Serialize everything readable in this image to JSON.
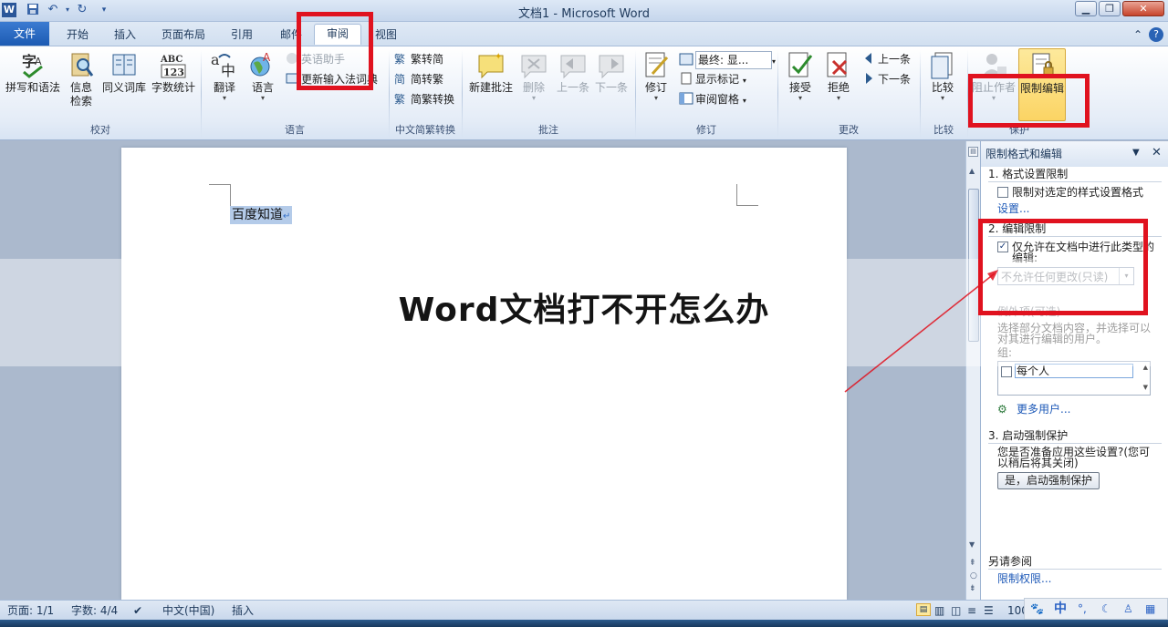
{
  "window": {
    "title": "文档1 - Microsoft Word"
  },
  "tabs": {
    "file": "文件",
    "items": [
      "开始",
      "插入",
      "页面布局",
      "引用",
      "邮件",
      "审阅",
      "视图"
    ]
  },
  "ribbon": {
    "proofing": {
      "spell": "拼写和语法",
      "research_1": "信息",
      "research_2": "检索",
      "thesaurus": "同义词库",
      "wordcount": "字数统计",
      "group": "校对"
    },
    "language": {
      "translate": "翻译",
      "language": "语言",
      "english_assistant": "英语助手",
      "update_ime": "更新输入法词典",
      "group": "语言"
    },
    "chinese": {
      "to_simplified": "繁转简",
      "to_traditional": "简转繁",
      "convert": "简繁转换",
      "group": "中文简繁转换"
    },
    "comments": {
      "new": "新建批注",
      "delete": "删除",
      "prev": "上一条",
      "next": "下一条",
      "group": "批注"
    },
    "tracking": {
      "track": "修订",
      "display_dropdown": "最终: 显...",
      "show_markup": "显示标记",
      "review_pane": "审阅窗格",
      "group": "修订"
    },
    "changes": {
      "accept": "接受",
      "reject": "拒绝",
      "prev": "上一条",
      "next": "下一条",
      "group": "更改"
    },
    "compare": {
      "compare": "比较",
      "group": "比较"
    },
    "protect": {
      "block_authors": "阻止作者",
      "restrict_editing": "限制编辑",
      "group": "保护"
    }
  },
  "document": {
    "text": "百度知道"
  },
  "task_pane": {
    "title": "限制格式和编辑",
    "section1_title": "1. 格式设置限制",
    "section1_check": "限制对选定的样式设置格式",
    "section1_link": "设置...",
    "section2_title": "2. 编辑限制",
    "section2_check_line1": "仅允许在文档中进行此类型的",
    "section2_check_line2": "编辑:",
    "edit_type": "不允许任何更改(只读)",
    "exceptions_title": "例外项(可选)",
    "exceptions_desc_line1": "选择部分文档内容，并选择可以",
    "exceptions_desc_line2": "对其进行编辑的用户。",
    "groups_label": "组:",
    "everyone": "每个人",
    "more_users": "更多用户...",
    "section3_title": "3. 启动强制保护",
    "section3_desc_line1": "您是否准备应用这些设置?(您可",
    "section3_desc_line2": "以稍后将其关闭)",
    "enforce_button": "是，启动强制保护",
    "see_also": "另请参阅",
    "permissions_link": "限制权限..."
  },
  "statusbar": {
    "page": "页面: 1/1",
    "words": "字数: 4/4",
    "language": "中文(中国)",
    "mode": "插入",
    "zoom": "100"
  },
  "overlay": {
    "headline": "Word文档打不开怎么办"
  },
  "ime": {
    "mode": "中",
    "punct": "°,"
  }
}
